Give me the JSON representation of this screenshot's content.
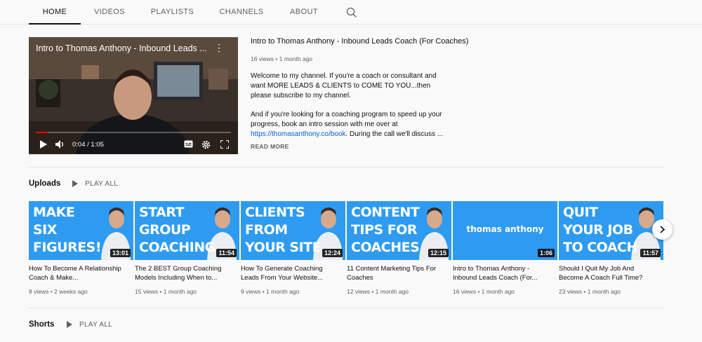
{
  "tabs": [
    {
      "label": "HOME",
      "active": true
    },
    {
      "label": "VIDEOS",
      "active": false
    },
    {
      "label": "PLAYLISTS",
      "active": false
    },
    {
      "label": "CHANNELS",
      "active": false
    },
    {
      "label": "ABOUT",
      "active": false
    }
  ],
  "featured": {
    "player_title": "Intro to Thomas Anthony - Inbound Leads ...",
    "time": "0:04 / 1:05",
    "progress": 0.06,
    "title": "Intro to Thomas Anthony - Inbound Leads Coach (For Coaches)",
    "meta": "16 views • 1 month ago",
    "desc1": "Welcome to my channel. If you're a coach or consultant and want MORE LEADS & CLIENTS to COME TO YOU...then please subscribe to my channel.",
    "desc2_pre": "And if you're looking for a coaching program to speed up your progress, book an intro session with me over at",
    "desc2_link": "https://thomasanthony.co/book",
    "desc2_post": ". During the call we'll discuss ...",
    "read_more": "READ MORE"
  },
  "uploads": {
    "title": "Uploads",
    "play_all": "PLAY ALL",
    "videos": [
      {
        "thumb_text": "MAKE\nSIX\nFIGURES!",
        "duration": "13:01",
        "title": "How To Become A Relationship Coach & Make...",
        "meta": "8 views • 2 weeks ago"
      },
      {
        "thumb_text": "START\nGROUP\nCOACHING",
        "duration": "11:54",
        "title": "The 2 BEST Group Coaching Models Including When to...",
        "meta": "15 views • 1 month ago"
      },
      {
        "thumb_text": "CLIENTS\nFROM\nYOUR SITE",
        "duration": "12:24",
        "title": "How To Generate Coaching Leads From Your Website...",
        "meta": "9 views • 1 month ago"
      },
      {
        "thumb_text": "CONTENT\nTIPS FOR\nCOACHES",
        "duration": "12:15",
        "title": "11 Content Marketing Tips For Coaches",
        "meta": "12 views • 1 month ago"
      },
      {
        "thumb_text": "thomas anthony",
        "duration": "1:06",
        "title": "Intro to Thomas Anthony - Inbound Leads Coach (For...",
        "meta": "16 views • 1 month ago"
      },
      {
        "thumb_text": "QUIT\nYOUR JOB\nTO COACH",
        "duration": "11:57",
        "title": "Should I Quit My Job And Become A Coach Full Time?",
        "meta": "23 views • 1 month ago"
      }
    ]
  },
  "shorts": {
    "title": "Shorts",
    "play_all": "PLAY ALL"
  },
  "colors": {
    "thumb_blue": "#2e9bf0",
    "link": "#065fd4",
    "progress_red": "#ff0000"
  }
}
